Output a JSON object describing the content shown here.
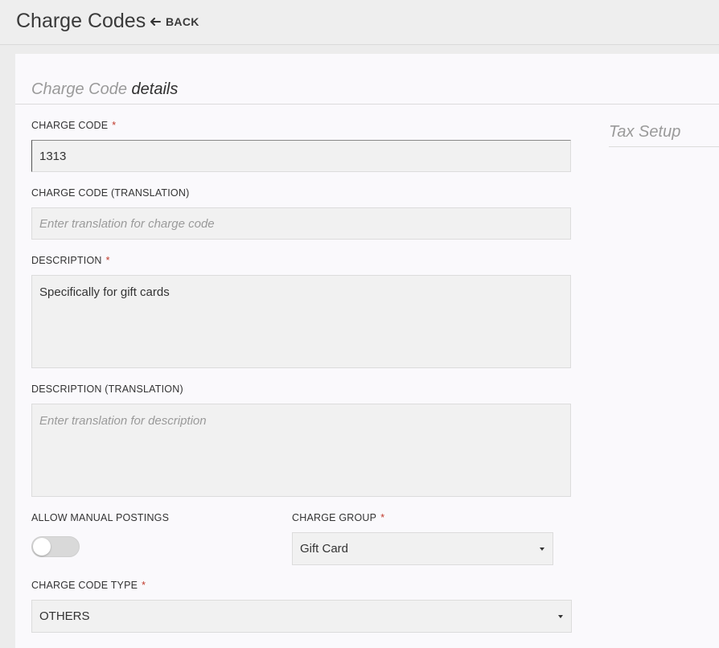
{
  "header": {
    "title": "Charge Codes",
    "back_label": "BACK"
  },
  "section": {
    "title_light": "Charge Code",
    "title_strong": "details",
    "tax_title": "Tax Setup"
  },
  "form": {
    "charge_code": {
      "label": "CHARGE CODE",
      "required": "*",
      "value": "1313"
    },
    "charge_code_translation": {
      "label": "CHARGE CODE (TRANSLATION)",
      "placeholder": "Enter translation for charge code",
      "value": ""
    },
    "description": {
      "label": "DESCRIPTION",
      "required": "*",
      "value": "Specifically for gift cards"
    },
    "description_translation": {
      "label": "DESCRIPTION (TRANSLATION)",
      "placeholder": "Enter translation for description",
      "value": ""
    },
    "allow_manual_postings": {
      "label": "ALLOW MANUAL POSTINGS",
      "enabled": false
    },
    "charge_group": {
      "label": "CHARGE GROUP",
      "required": "*",
      "selected": "Gift Card"
    },
    "charge_code_type": {
      "label": "CHARGE CODE TYPE",
      "required": "*",
      "selected": "OTHERS"
    }
  },
  "colors": {
    "required": "#c0392b",
    "field_bg": "#f1f1f1",
    "card_bg": "#faf9fc",
    "page_bg": "#ececec"
  }
}
